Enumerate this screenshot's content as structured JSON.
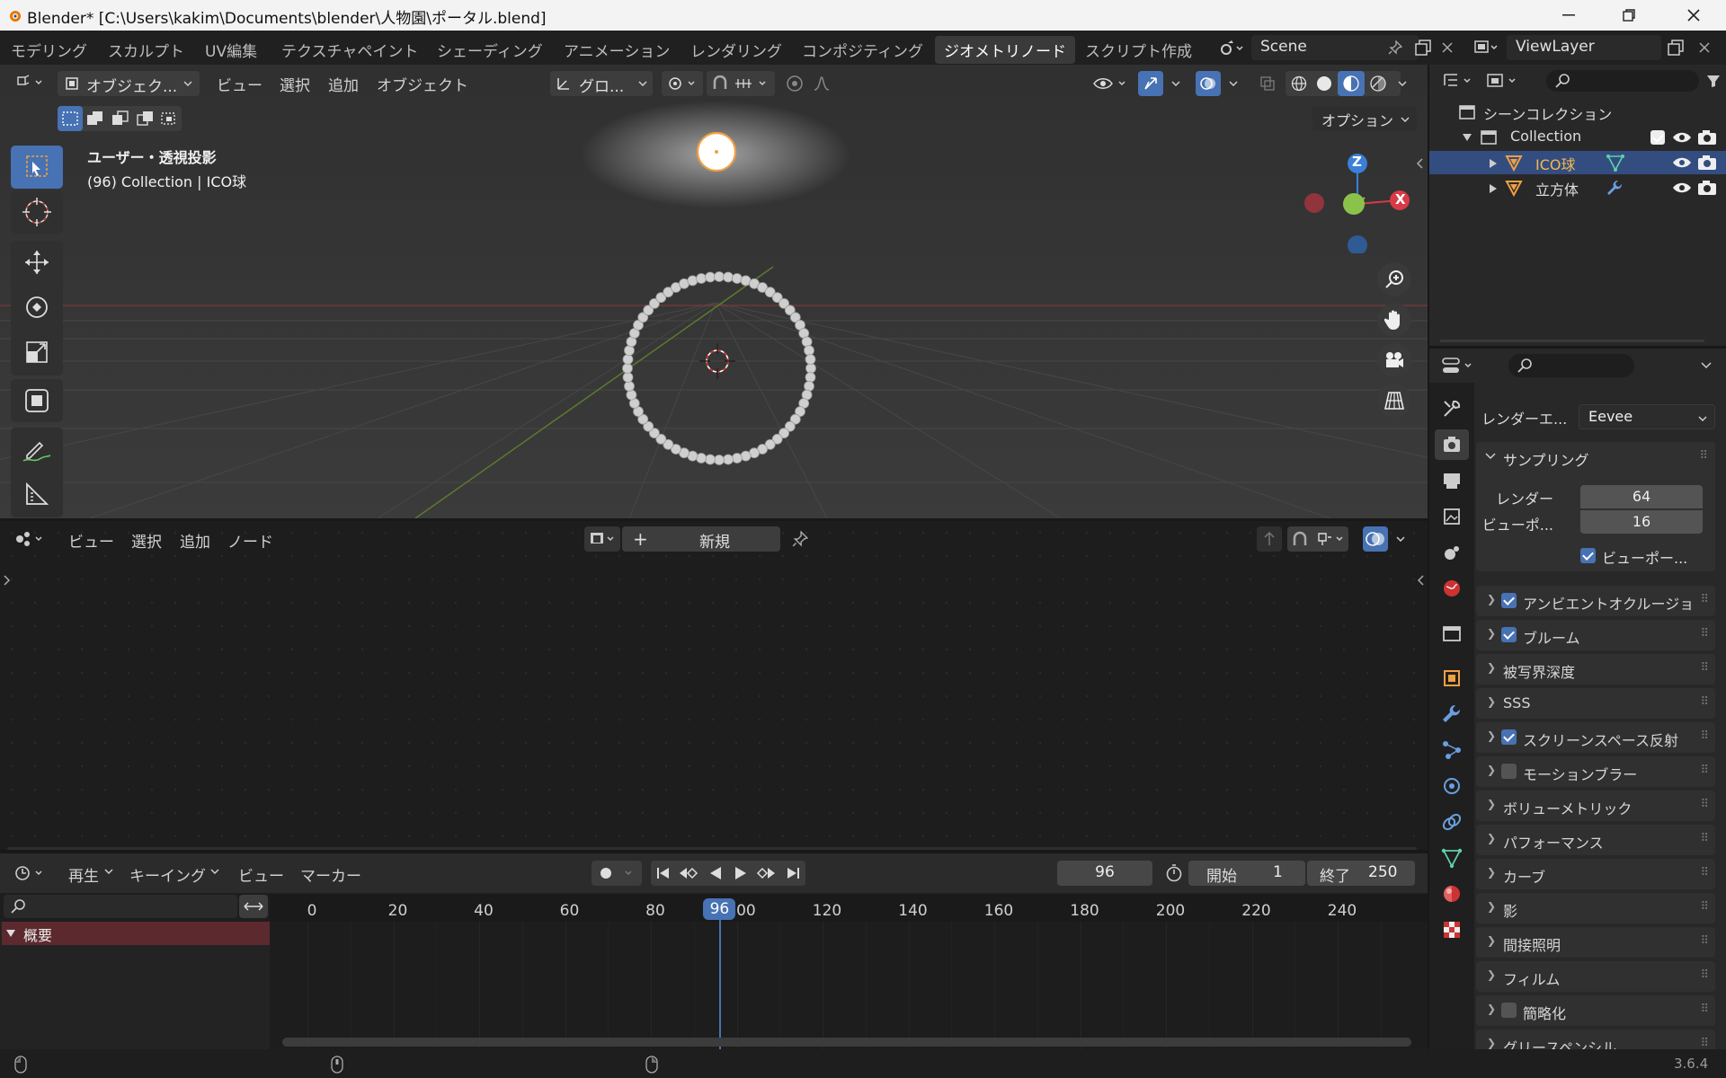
{
  "window": {
    "title": "Blender* [C:\\Users\\kakim\\Documents\\blender\\人物園\\ポータル.blend]"
  },
  "tabs": [
    "モデリング",
    "スカルプト",
    "UV編集",
    "テクスチャペイント",
    "シェーディング",
    "アニメーション",
    "レンダリング",
    "コンポジティング",
    "ジオメトリノード",
    "スクリプト作成"
  ],
  "scene": {
    "name": "Scene",
    "viewlayer": "ViewLayer"
  },
  "viewport": {
    "mode": "オブジェク...",
    "menus": [
      "ビュー",
      "選択",
      "追加",
      "オブジェクト"
    ],
    "orientation": "グロ...",
    "options": "オプション",
    "info1": "ユーザー・透視投影",
    "info2": "(96) Collection | ICO球",
    "gizmo": {
      "z": "Z",
      "x": "X"
    }
  },
  "node_editor": {
    "menus": [
      "ビュー",
      "選択",
      "追加",
      "ノード"
    ],
    "new_label": "新規",
    "new_plus": "+"
  },
  "timeline": {
    "menus": [
      "再生",
      "キーイング",
      "ビュー",
      "マーカー"
    ],
    "current_frame": "96",
    "start_label": "開始",
    "start": "1",
    "end_label": "終了",
    "end": "250",
    "ticks": [
      "0",
      "20",
      "40",
      "60",
      "80",
      "100",
      "120",
      "140",
      "160",
      "180",
      "200",
      "220",
      "240"
    ],
    "channel": "概要"
  },
  "outliner": {
    "root": "シーンコレクション",
    "collection": "Collection",
    "items": [
      "ICO球",
      "立方体"
    ]
  },
  "properties": {
    "engine_label": "レンダーエ...",
    "engine": "Eevee",
    "sampling": "サンプリング",
    "render_label": "レンダー",
    "render_value": "64",
    "viewport_label": "ビューポ...",
    "viewport_value": "16",
    "viewport_denoise": "ビューポー...",
    "panels": [
      {
        "label": "アンビエントオクルージョン",
        "checkbox": "on"
      },
      {
        "label": "ブルーム",
        "checkbox": "on"
      },
      {
        "label": "被写界深度",
        "checkbox": "none"
      },
      {
        "label": "SSS",
        "checkbox": "none"
      },
      {
        "label": "スクリーンスペース反射",
        "checkbox": "on"
      },
      {
        "label": "モーションブラー",
        "checkbox": "off"
      },
      {
        "label": "ボリューメトリック",
        "checkbox": "none"
      },
      {
        "label": "パフォーマンス",
        "checkbox": "none"
      },
      {
        "label": "カーブ",
        "checkbox": "none"
      },
      {
        "label": "影",
        "checkbox": "none"
      },
      {
        "label": "間接照明",
        "checkbox": "none"
      },
      {
        "label": "フィルム",
        "checkbox": "none"
      },
      {
        "label": "簡略化",
        "checkbox": "off"
      },
      {
        "label": "グリースペンシル",
        "checkbox": "none"
      }
    ]
  },
  "status": {
    "version": "3.6.4"
  },
  "colors": {
    "accent": "#4772b3",
    "selected": "#f0a040",
    "axis_x": "#d63b47",
    "axis_y": "#8bc34a",
    "axis_z": "#3b7fd6"
  }
}
